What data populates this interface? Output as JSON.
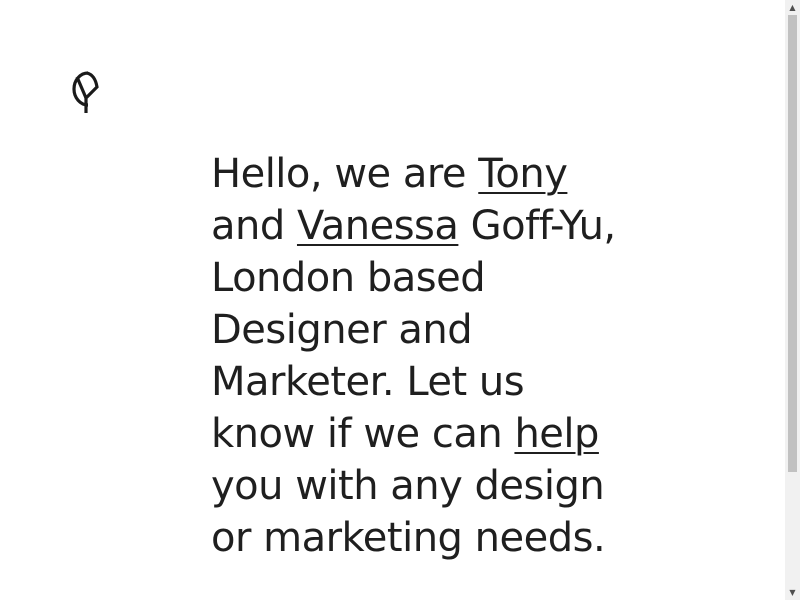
{
  "logo": {
    "icon": "cy-monogram-icon"
  },
  "intro": {
    "part1": "Hello, we are ",
    "link1": "Tony",
    "part2": " and ",
    "link2": "Vanessa",
    "part3": " Goff-Yu, London based Designer and Marketer. Let us know if we can ",
    "link3": "help",
    "part4": " you with any design or marketing needs."
  },
  "scrollbar": {
    "up_icon": "▲",
    "down_icon": "▼"
  }
}
